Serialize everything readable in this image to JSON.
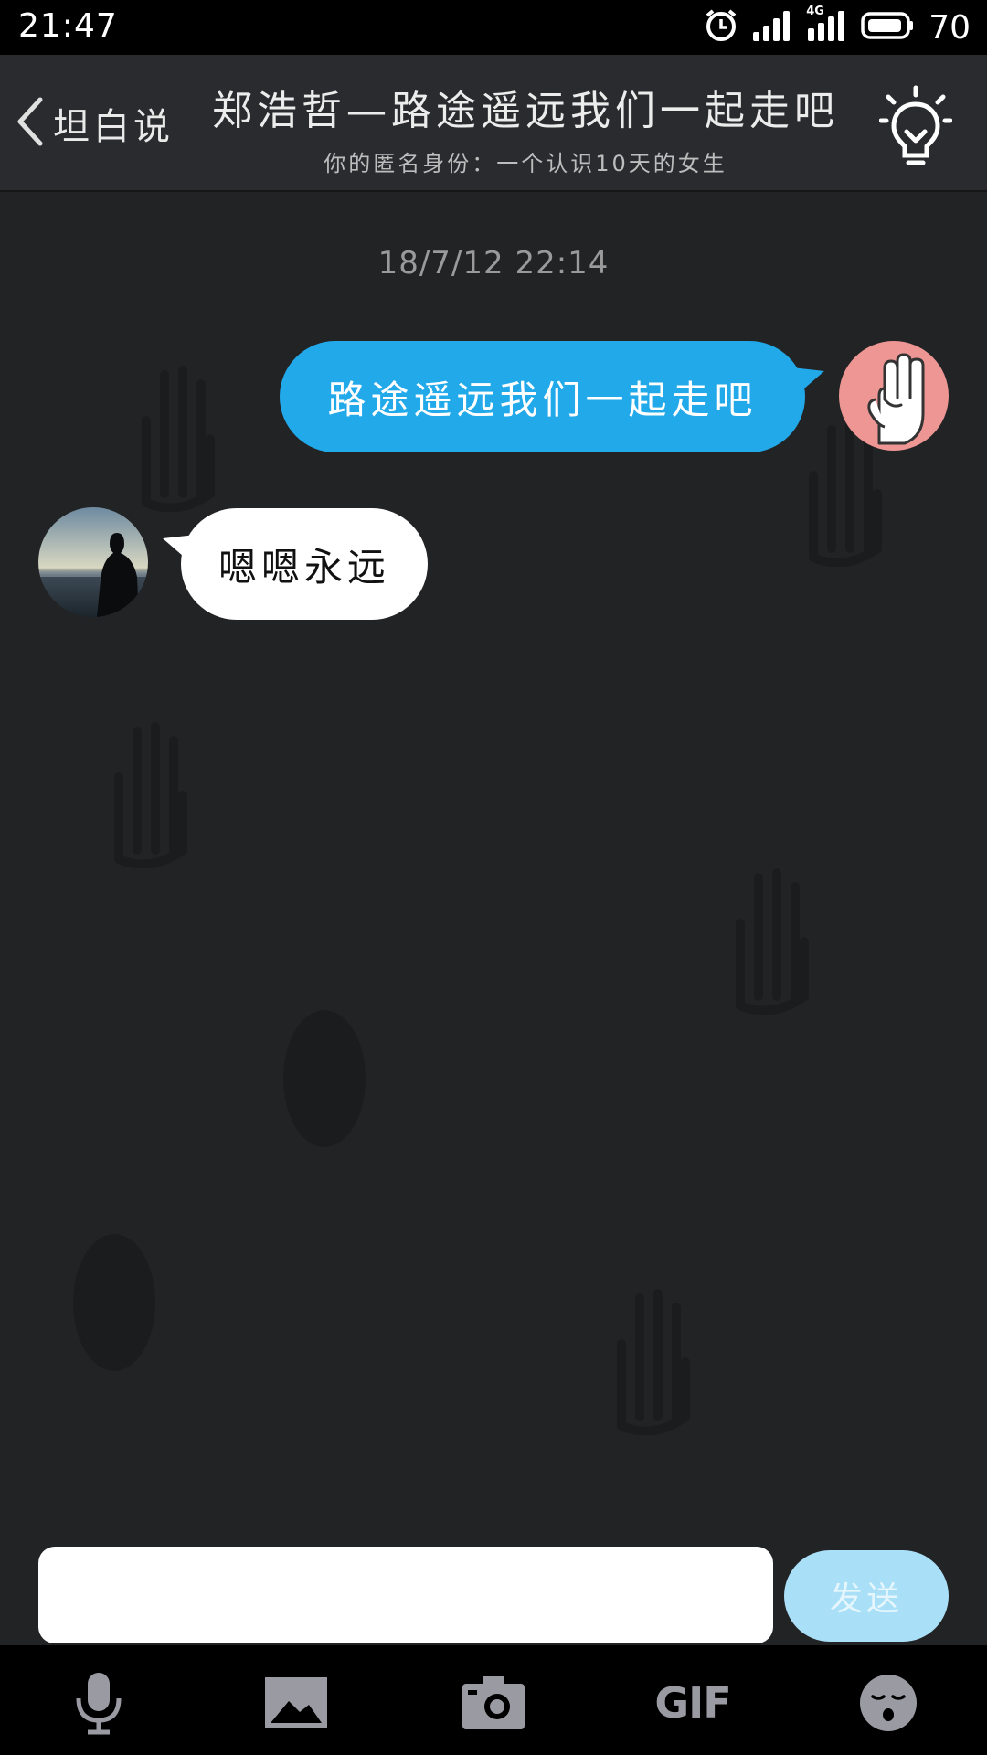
{
  "status_bar": {
    "time": "21:47",
    "network": "4G",
    "battery": "70",
    "icons": [
      "alarm-icon",
      "signal-icon",
      "signal-4g-icon",
      "battery-icon"
    ]
  },
  "header": {
    "back_label": "坦白说",
    "title": "郑浩哲—路途遥远我们一起走吧",
    "subtitle": "你的匿名身份：一个认识10天的女生",
    "right_icon": "lightbulb-icon"
  },
  "chat": {
    "timestamp": "18/7/12 22:14",
    "messages": [
      {
        "direction": "outgoing",
        "text": "路途遥远我们一起走吧",
        "avatar": "three-fingers-hand-avatar"
      },
      {
        "direction": "incoming",
        "text": "嗯嗯永远",
        "avatar": "silhouette-photo-avatar"
      }
    ]
  },
  "composer": {
    "input_value": "",
    "send_label": "发送"
  },
  "toolbar": {
    "items": [
      "microphone-icon",
      "image-icon",
      "camera-icon",
      "gif-icon",
      "emoji-icon"
    ],
    "gif_label": "GIF"
  },
  "colors": {
    "outgoing_bubble": "#22a9ea",
    "incoming_bubble": "#ffffff",
    "chat_bg": "#222325",
    "send_button": "#a9dff7",
    "avatar_bg": "#ee9694"
  }
}
